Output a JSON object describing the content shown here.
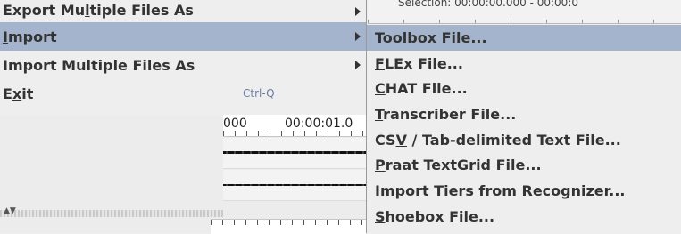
{
  "background": {
    "selection_text": "Selection: 00:00:00.000 - 00:00:0",
    "ruler_labels": [
      "000",
      "00:00:01.0"
    ]
  },
  "file_menu": {
    "items": [
      {
        "id": "export-multiple",
        "pre": "Export Mu",
        "mn": "l",
        "post": "tiple Files As",
        "has_submenu": true
      },
      {
        "id": "import",
        "pre": "",
        "mn": "I",
        "post": "mport",
        "has_submenu": true,
        "highlighted": true
      },
      {
        "id": "import-multiple",
        "pre": "Import Multiple Files As",
        "mn": "",
        "post": "",
        "has_submenu": true
      },
      {
        "id": "exit",
        "pre": "E",
        "mn": "x",
        "post": "it",
        "accelerator": "Ctrl-Q"
      }
    ]
  },
  "import_submenu": {
    "items": [
      {
        "id": "toolbox",
        "pre": "Toolbox File...",
        "mn": "",
        "post": "",
        "highlighted": true
      },
      {
        "id": "flex",
        "pre": "",
        "mn": "F",
        "post": "LEx File..."
      },
      {
        "id": "chat",
        "pre": "",
        "mn": "C",
        "post": "HAT File..."
      },
      {
        "id": "transcriber",
        "pre": "",
        "mn": "T",
        "post": "ranscriber File..."
      },
      {
        "id": "csv",
        "pre": "CS",
        "mn": "V",
        "post": " / Tab-delimited Text File..."
      },
      {
        "id": "praat",
        "pre": "",
        "mn": "P",
        "post": "raat TextGrid File..."
      },
      {
        "id": "recognizer",
        "pre": "Import Tiers from Recognizer...",
        "mn": "",
        "post": ""
      },
      {
        "id": "shoebox",
        "pre": "",
        "mn": "S",
        "post": "hoebox File..."
      }
    ]
  },
  "colors": {
    "highlight": "#a3b4cc",
    "menu_bg": "#eeeeee",
    "text": "#333333",
    "accelerator": "#6b7fa6"
  }
}
